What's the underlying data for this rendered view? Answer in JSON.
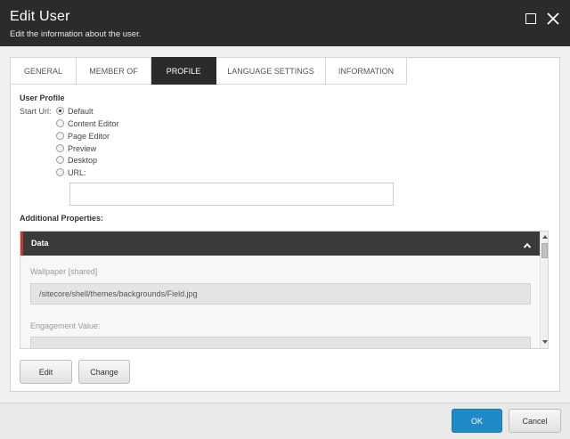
{
  "dialog": {
    "title": "Edit User",
    "subtitle": "Edit the information about the user."
  },
  "tabs": [
    {
      "label": "GENERAL",
      "active": false
    },
    {
      "label": "MEMBER OF",
      "active": false
    },
    {
      "label": "PROFILE",
      "active": true
    },
    {
      "label": "LANGUAGE SETTINGS",
      "active": false
    },
    {
      "label": "INFORMATION",
      "active": false
    }
  ],
  "profile": {
    "section_title": "User Profile",
    "start_url_label": "Start Url:",
    "options": [
      {
        "label": "Default",
        "checked": true
      },
      {
        "label": "Content Editor",
        "checked": false
      },
      {
        "label": "Page Editor",
        "checked": false
      },
      {
        "label": "Preview",
        "checked": false
      },
      {
        "label": "Desktop",
        "checked": false
      },
      {
        "label": "URL:",
        "checked": false
      }
    ],
    "url_value": ""
  },
  "additional": {
    "label": "Additional Properties:",
    "section_header": "Data",
    "fields": [
      {
        "label": "Wallpaper [shared]",
        "value": "/sitecore/shell/themes/backgrounds/Field.jpg"
      },
      {
        "label": "Engagement Value:",
        "value": ""
      }
    ]
  },
  "buttons": {
    "edit": "Edit",
    "change": "Change",
    "ok": "OK",
    "cancel": "Cancel"
  },
  "colors": {
    "titlebar": "#2b2b2b",
    "accent_red": "#c0392b",
    "ok_blue": "#1f8ac8"
  },
  "icons": {
    "maximize": "maximize-icon",
    "close": "close-icon",
    "collapse": "chevron-up-icon"
  }
}
